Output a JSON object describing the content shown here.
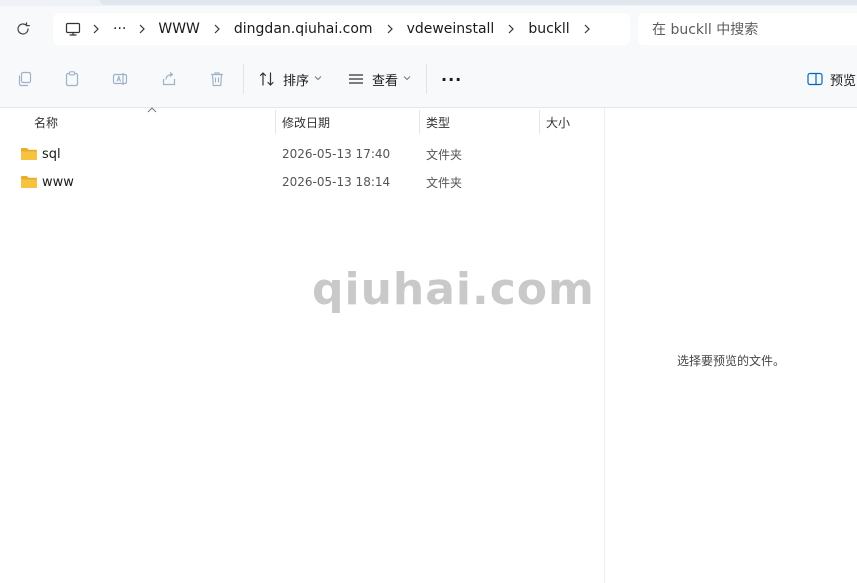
{
  "breadcrumb": {
    "items": [
      "WWW",
      "dingdan.qiuhai.com",
      "vdeweinstall",
      "buckll"
    ],
    "overflow": "···"
  },
  "search": {
    "placeholder": "在 buckll 中搜索"
  },
  "toolbar": {
    "sort_label": "排序",
    "view_label": "查看",
    "more_label": "···",
    "preview_label": "预览"
  },
  "columns": {
    "name": "名称",
    "modified": "修改日期",
    "type": "类型",
    "size": "大小"
  },
  "files": [
    {
      "name": "sql",
      "modified": "2026-05-13 17:40",
      "type": "文件夹"
    },
    {
      "name": "www",
      "modified": "2026-05-13 18:14",
      "type": "文件夹"
    }
  ],
  "preview": {
    "empty_message": "选择要预览的文件。"
  },
  "watermark": "qiuhai.com",
  "colors": {
    "folder": "#f5c242",
    "folder_dark": "#e9ad2c",
    "accent": "#0067c0"
  }
}
